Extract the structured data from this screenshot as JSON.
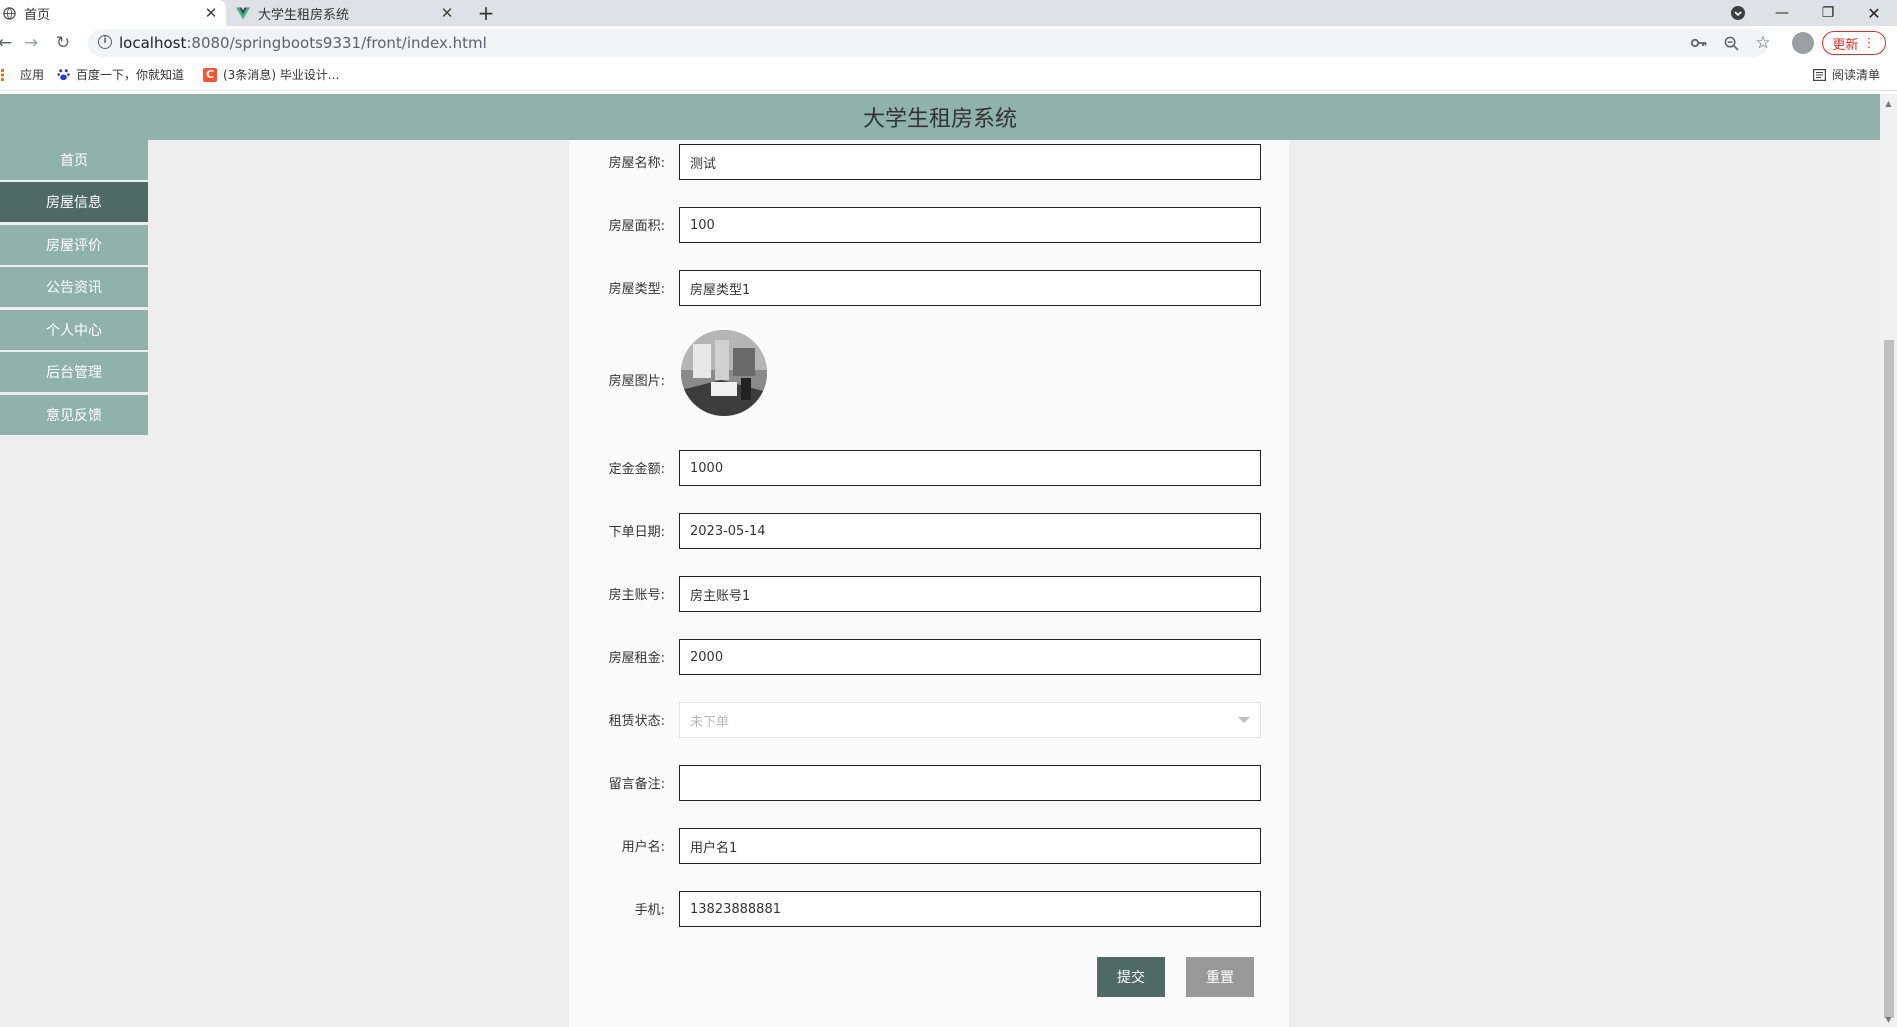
{
  "browser": {
    "tabs": [
      {
        "title": "首页",
        "active": true
      },
      {
        "title": "大学生租房系统",
        "active": false
      }
    ],
    "url_host": "localhost",
    "url_path": ":8080/springboots9331/front/index.html",
    "update_label": "更新",
    "bookmarks": [
      {
        "label": "应用"
      },
      {
        "label": "百度一下，你就知道"
      },
      {
        "label": "(3条消息) 毕业设计..."
      }
    ],
    "reading_list_label": "阅读清单"
  },
  "header": {
    "title": "大学生租房系统"
  },
  "sidebar": {
    "items": [
      {
        "label": "首页"
      },
      {
        "label": "房屋信息"
      },
      {
        "label": "房屋评价"
      },
      {
        "label": "公告资讯"
      },
      {
        "label": "个人中心"
      },
      {
        "label": "后台管理"
      },
      {
        "label": "意见反馈"
      }
    ]
  },
  "form": {
    "house_name": {
      "label": "房屋名称:",
      "value": "测试"
    },
    "area": {
      "label": "房屋面积:",
      "value": "100"
    },
    "house_type": {
      "label": "房屋类型:",
      "value": "房屋类型1"
    },
    "photo": {
      "label": "房屋图片:"
    },
    "deposit": {
      "label": "定金金额:",
      "value": "1000"
    },
    "order_date": {
      "label": "下单日期:",
      "value": "2023-05-14"
    },
    "owner_account": {
      "label": "房主账号:",
      "value": "房主账号1"
    },
    "rent": {
      "label": "房屋租金:",
      "value": "2000"
    },
    "rent_status": {
      "label": "租赁状态:",
      "value": "未下单"
    },
    "remark": {
      "label": "留言备注:",
      "value": ""
    },
    "username": {
      "label": "用户名:",
      "value": "用户名1"
    },
    "phone": {
      "label": "手机:",
      "value": "13823888881"
    },
    "submit_label": "提交",
    "reset_label": "重置"
  },
  "colors": {
    "header_bg": "#8fb3a8",
    "nav_active": "#4e6a62",
    "submit_bg": "#4e6a62",
    "reset_bg": "#999999"
  }
}
